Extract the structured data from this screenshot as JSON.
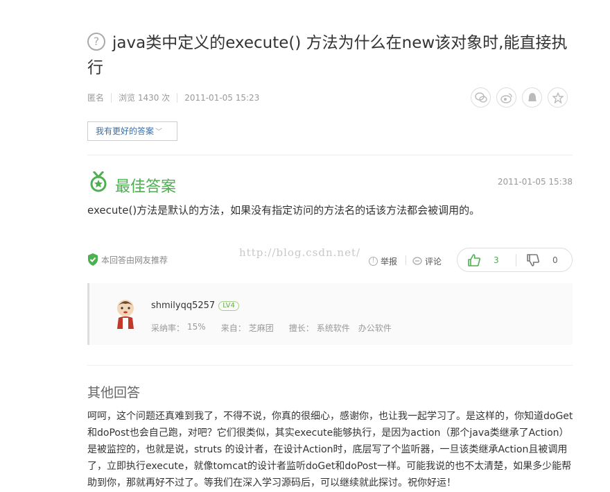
{
  "question": {
    "icon": "question-circle-icon",
    "title": "java类中定义的execute() 方法为什么在new该对象时,能直接执行",
    "author": "匿名",
    "views": "浏览 1430 次",
    "time": "2011-01-05 15:23"
  },
  "share_icons": [
    "wechat-icon",
    "weibo-icon",
    "qq-icon",
    "favorite-icon"
  ],
  "better_answer_button": "我有更好的答案",
  "best": {
    "label": "最佳答案",
    "time": "2011-01-05 15:38",
    "answer": "execute()方法是默认的方法，如果没有指定访问的方法名的话该方法都会被调用的。",
    "recommend": "本回答由网友推荐",
    "report": "举报",
    "comment": "评论",
    "upvotes": "3",
    "downvotes": "0"
  },
  "watermark": "http://blog.csdn.net/",
  "author": {
    "name": "shmilyqq5257",
    "level": "LV4",
    "adopt_rate_label": "采纳率：",
    "adopt_rate": "15%",
    "from_label": "来自：",
    "from": "芝麻团",
    "expertise_label": "擅长：",
    "expertise": [
      "系统软件",
      "办公软件"
    ]
  },
  "other": {
    "title": "其他回答",
    "body": "呵呵，这个问题还真难到我了，不得不说，你真的很细心，感谢你，也让我一起学习了。是这样的，你知道doGet和doPost也会自己跑，对吧？它们很类似，其实execute能够执行，是因为action（那个java类继承了Action）是被监控的，也就是说，struts 的设计者，在设计Action时，底层写了个监听器，一旦该类继承Action且被调用了，立即执行execute，就像tomcat的设计者监听doGet和doPost一样。可能我说的也不太清楚，如果多少能帮助到你，那就再好不过了。等我们在深入学习源码后，可以继续就此探讨。祝你好运！"
  },
  "colors": {
    "accent_green": "#4caf50",
    "link_blue": "#3a6ea5"
  }
}
